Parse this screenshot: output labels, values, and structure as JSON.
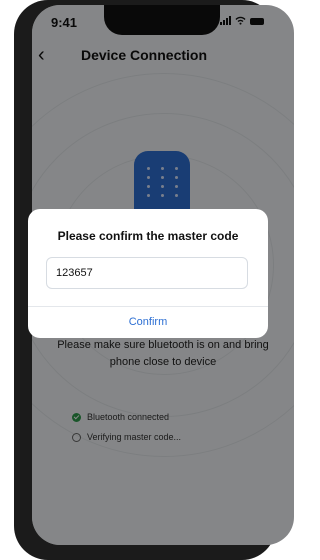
{
  "status_bar": {
    "time": "9:41"
  },
  "header": {
    "back_icon": "chevron-left-icon",
    "title": "Device Connection"
  },
  "instruction": {
    "text": "Please make sure bluetooth is on and bring phone close to device"
  },
  "steps": [
    {
      "label": "Bluetooth connected",
      "status": "done",
      "icon": "check-circle-icon"
    },
    {
      "label": "Verifying master code...",
      "status": "pending",
      "icon": "circle-icon"
    }
  ],
  "dialog": {
    "title": "Please confirm the master code",
    "code_value": "123657",
    "confirm_label": "Confirm"
  },
  "colors": {
    "accent": "#2d6fd3",
    "success": "#2e9c4b",
    "device": "#2f6fd3"
  }
}
